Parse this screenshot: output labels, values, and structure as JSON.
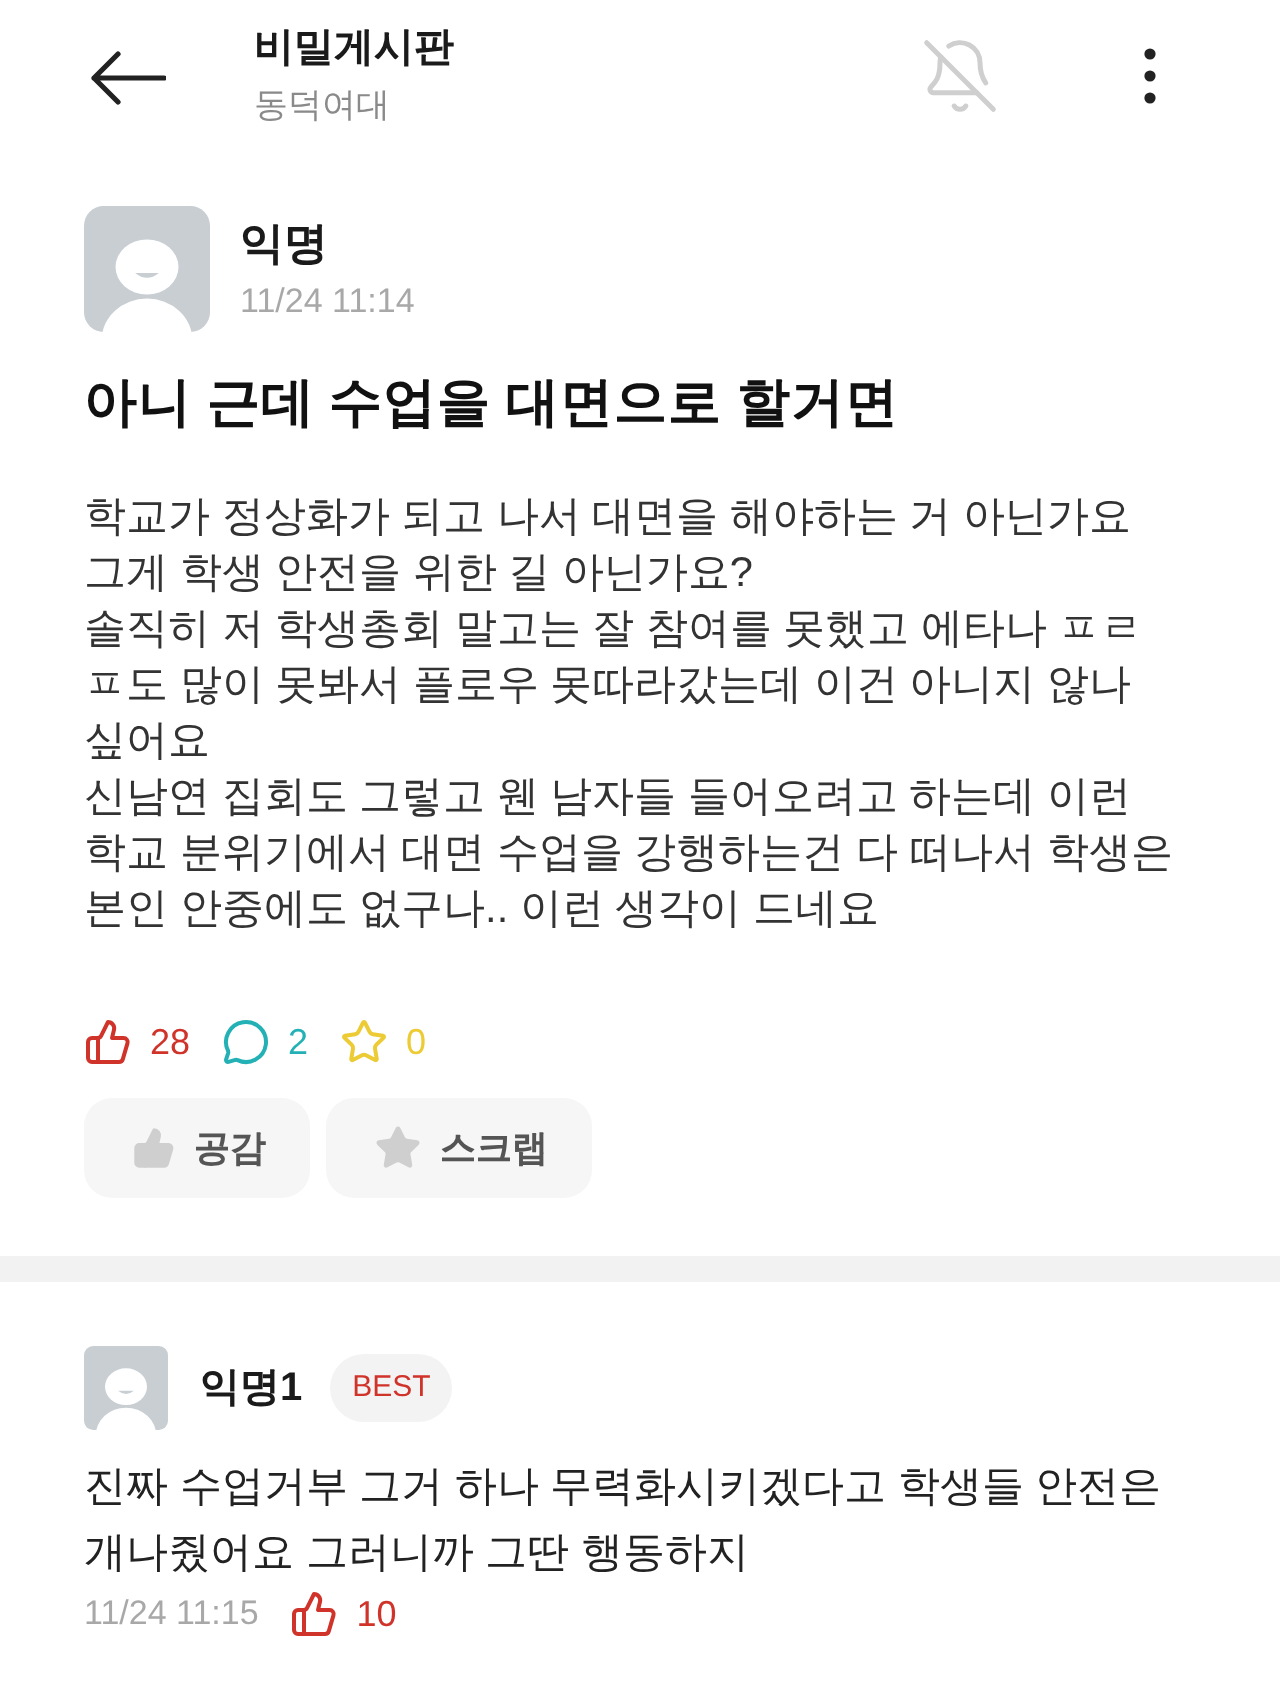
{
  "header": {
    "title": "비밀게시판",
    "subtitle": "동덕여대",
    "notifications": false
  },
  "post": {
    "author": "익명",
    "time": "11/24 11:14",
    "title": "아니 근데 수업을 대면으로 할거면",
    "body_lines": [
      "학교가 정상화가 되고 나서 대면을 해야하는 거 아닌가요",
      "그게 학생 안전을 위한 길 아닌가요?",
      "솔직히 저 학생총회 말고는 잘 참여를 못했고 에타나 ㅍㄹ",
      "ㅍ도 많이 못봐서 플로우 못따라갔는데 이건 아니지 않나",
      "싶어요",
      "신남연 집회도 그렇고 웬 남자들 들어오려고 하는데 이런",
      "학교 분위기에서 대면 수업을 강행하는건 다 떠나서 학생은",
      "본인 안중에도 없구나.. 이런 생각이 드네요"
    ],
    "stats": [
      {
        "kind": "like",
        "count": "28"
      },
      {
        "kind": "comment",
        "count": "2"
      },
      {
        "kind": "scrap",
        "count": "0"
      }
    ],
    "actions": [
      {
        "kind": "like",
        "label": "공감"
      },
      {
        "kind": "scrap",
        "label": "스크랩"
      }
    ]
  },
  "comments": [
    {
      "author": "익명1",
      "badge": "BEST",
      "text_lines": [
        "진짜 수업거부 그거 하나 무력화시키겠다고 학생들 안전은",
        "개나줬어요 그러니까 그딴 행동하지"
      ],
      "time": "11/24 11:15",
      "likes": "10"
    }
  ]
}
